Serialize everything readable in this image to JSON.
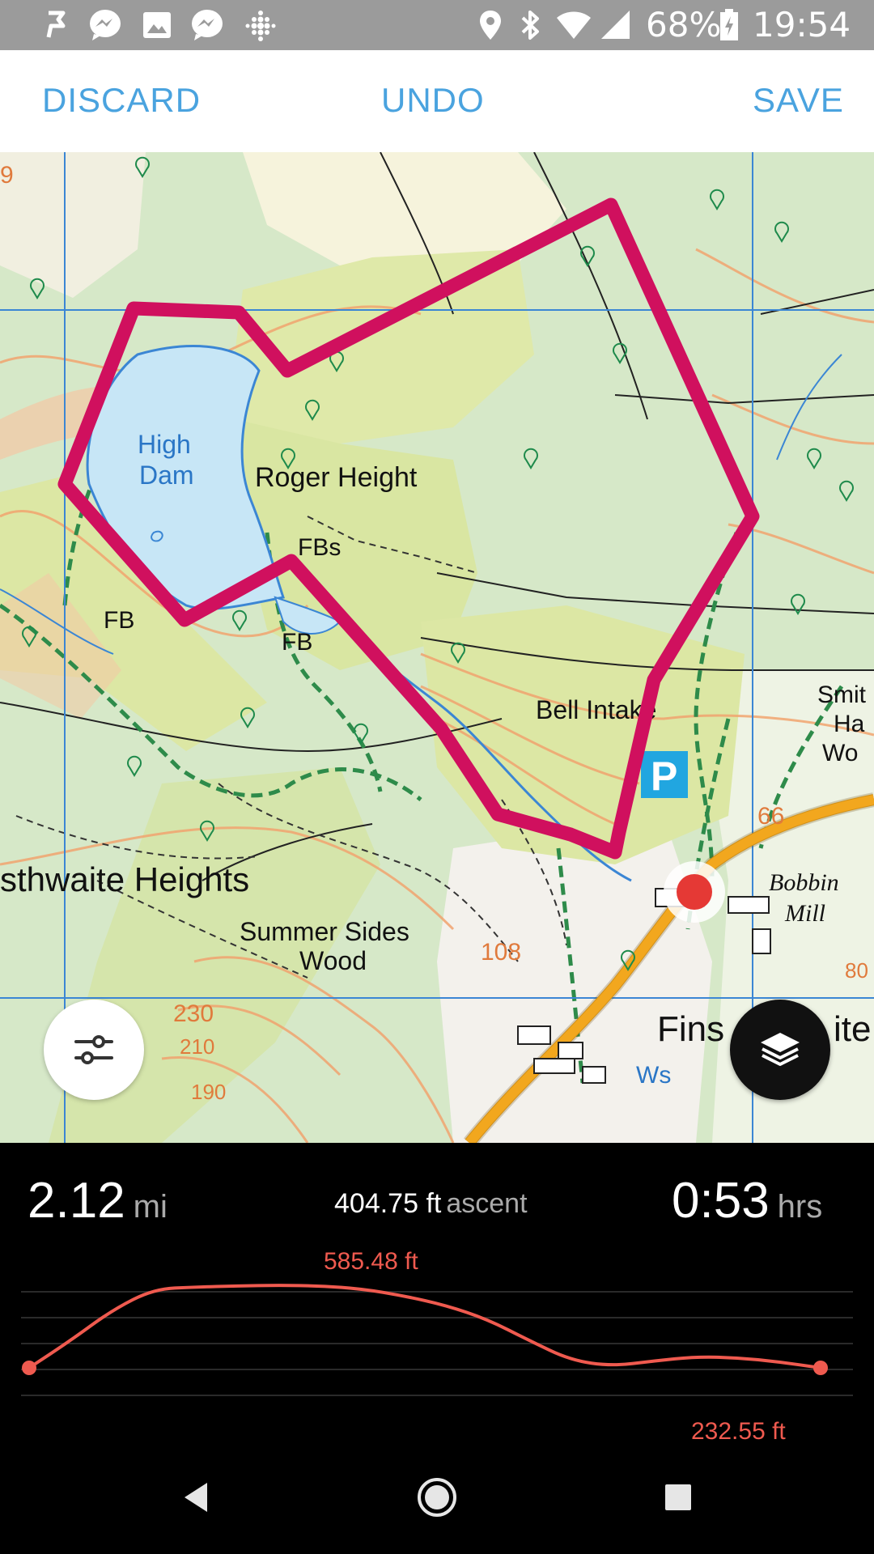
{
  "status_bar": {
    "icons_left": [
      "flag-icon",
      "messenger-icon",
      "image-icon",
      "messenger-icon",
      "fitbit-icon"
    ],
    "icons_right": [
      "location-icon",
      "bluetooth-icon",
      "wifi-icon",
      "signal-icon",
      "battery-charging-icon"
    ],
    "battery": "68%",
    "time": "19:54"
  },
  "action_bar": {
    "discard": "DISCARD",
    "undo": "UNDO",
    "save": "SAVE"
  },
  "map": {
    "labels": {
      "lake_1": "High",
      "lake_2": "Dam",
      "roger": "Roger Height",
      "fbs": "FBs",
      "fb1": "FB",
      "fb2": "FB",
      "bell": "Bell Intake",
      "heights": "sthwaite Heights",
      "summer_1": "Summer Sides",
      "summer_2": "Wood",
      "smit_1": "Smit",
      "smit_2": "Ha",
      "smit_3": "Wo",
      "bobbin_1": "Bobbin",
      "bobbin_2": "Mill",
      "fins": "Fins",
      "ite": "ite",
      "ws": "Ws",
      "h66": "66",
      "h108": "108",
      "h230": "230",
      "h210": "210",
      "h190": "190",
      "h80": "80",
      "h9": "9",
      "parking": "P"
    },
    "route_color": "#d0105e",
    "marker_color": "#e53935"
  },
  "stats": {
    "distance_value": "2.12",
    "distance_unit": "mi",
    "ascent_value": "404.75 ft",
    "ascent_unit": "ascent",
    "time_value": "0:53",
    "time_unit": "hrs",
    "elev_max": "585.48 ft",
    "elev_min": "232.55 ft"
  },
  "elevation_profile": {
    "line_color": "#ef5a4f",
    "points_ft": [
      232.55,
      350,
      480,
      570,
      578,
      583,
      585.48,
      583,
      570,
      540,
      500,
      440,
      350,
      265,
      240,
      262,
      280,
      276,
      258,
      232.55
    ],
    "max_ft": 585.48,
    "min_ft": 232.55
  },
  "nav_bar": {
    "back": "back-icon",
    "home": "home-icon",
    "recents": "recents-icon"
  }
}
